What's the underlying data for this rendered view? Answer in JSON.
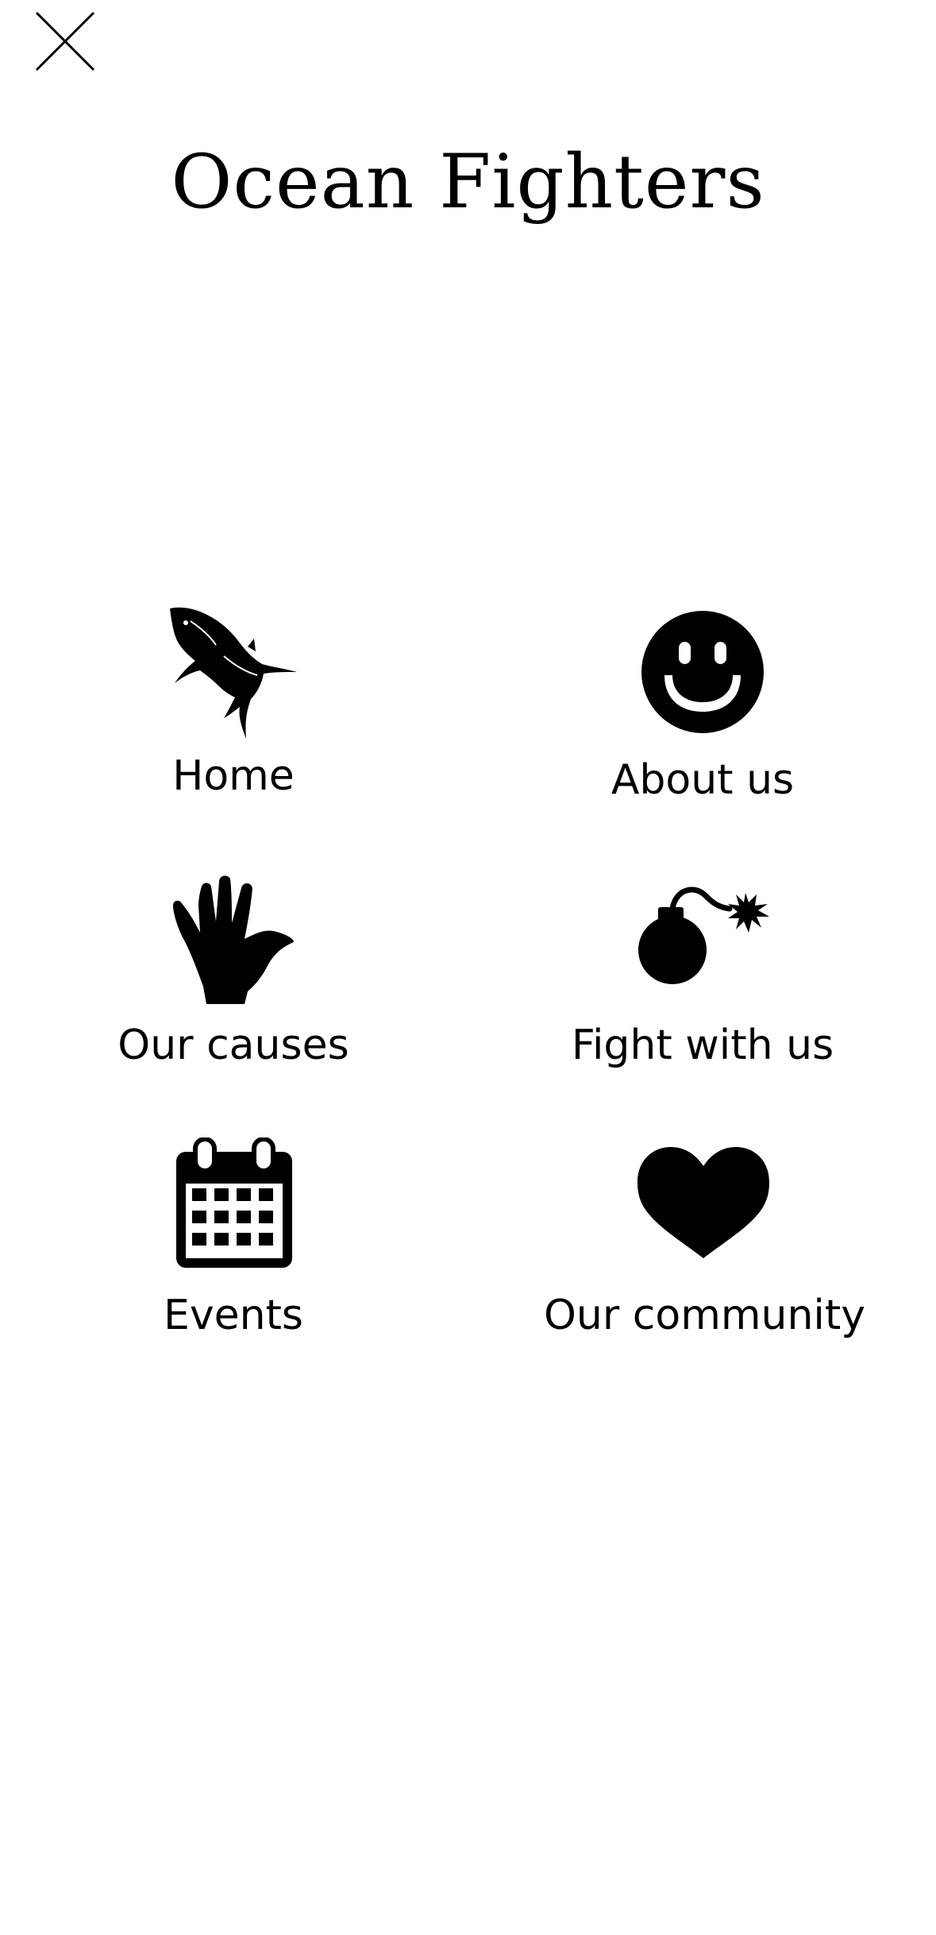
{
  "header": {
    "title": "Ocean Fighters",
    "close_icon": "close-icon"
  },
  "nav": {
    "items": [
      {
        "label": "Home",
        "icon": "shark-icon"
      },
      {
        "label": "About us",
        "icon": "smiley-icon"
      },
      {
        "label": "Our causes",
        "icon": "hand-icon"
      },
      {
        "label": "Fight with us",
        "icon": "bomb-icon"
      },
      {
        "label": "Events",
        "icon": "calendar-icon"
      },
      {
        "label": "Our community",
        "icon": "heart-icon"
      }
    ]
  },
  "colors": {
    "background": "#ffffff",
    "foreground": "#000000"
  }
}
